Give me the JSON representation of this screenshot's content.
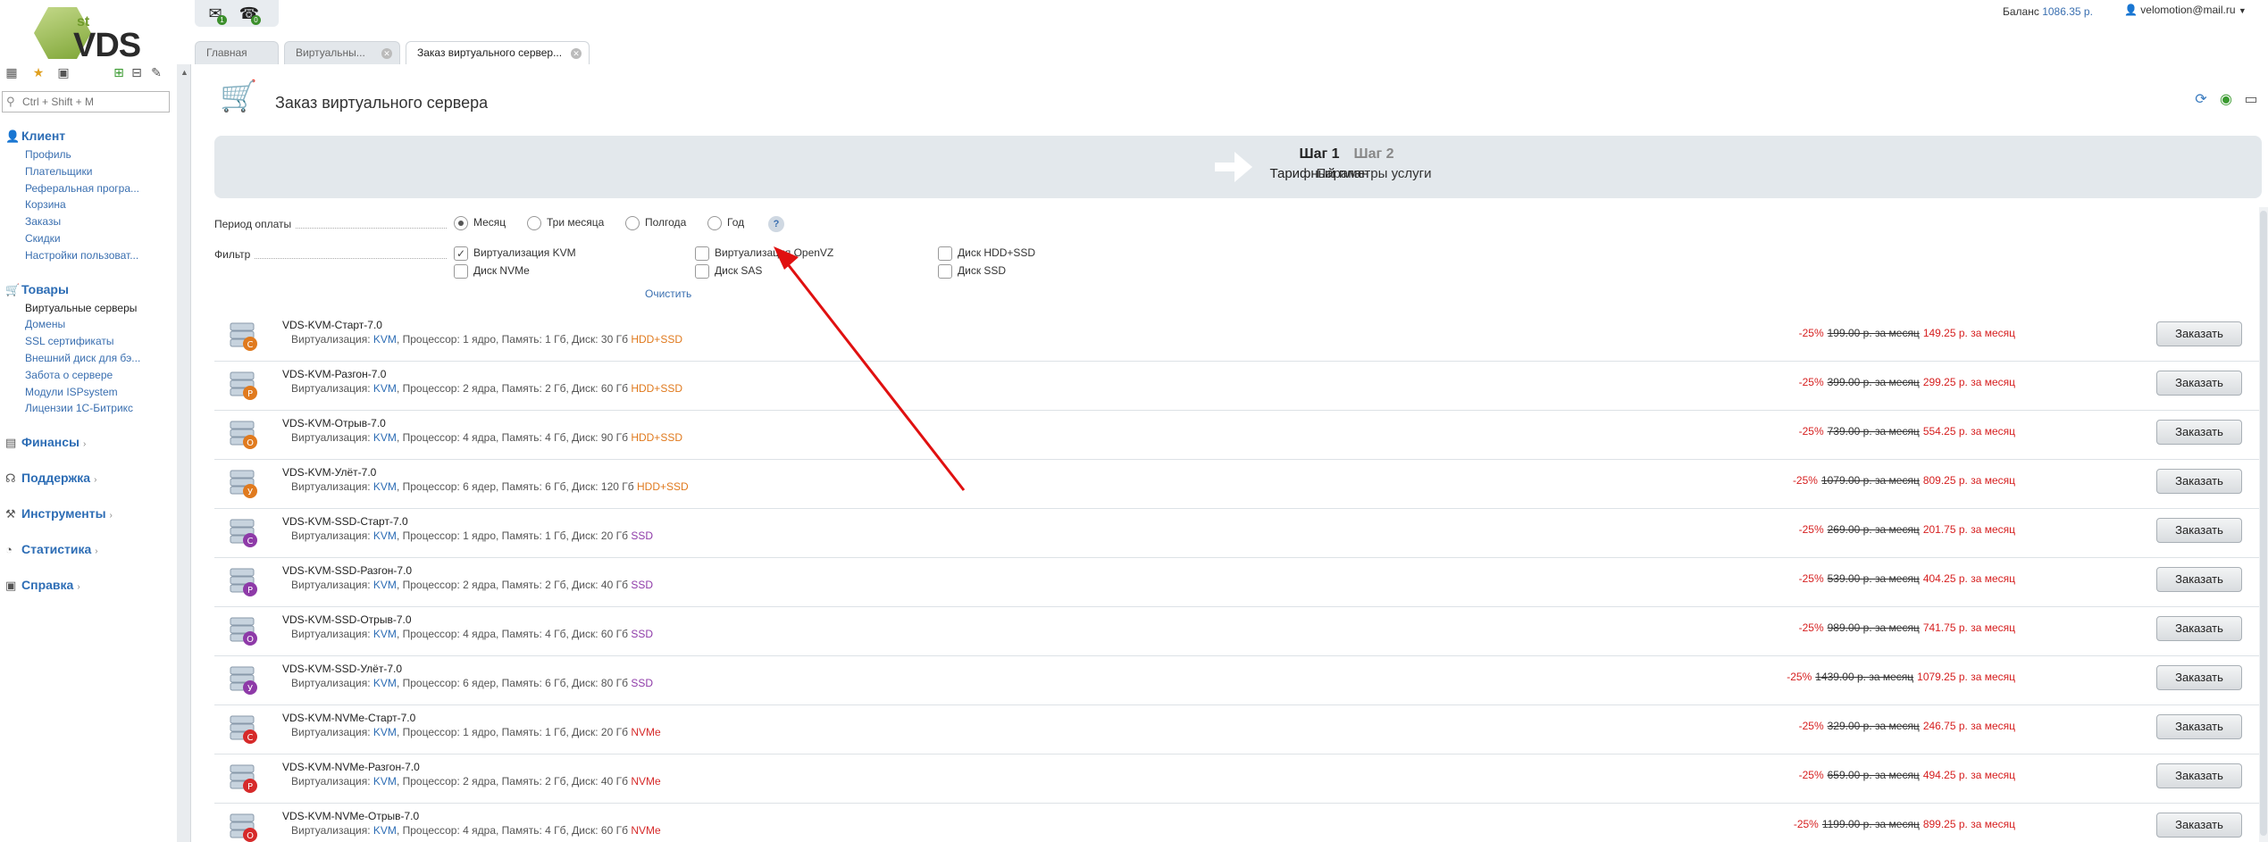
{
  "header": {
    "logo_sup": "st",
    "logo_text": "VDS",
    "balance_label": "Баланс",
    "balance_value": "1086.35 р.",
    "user_email": "velomotion@mail.ru"
  },
  "topbar_icons": [
    {
      "icon": "news-icon",
      "badge": "1"
    },
    {
      "icon": "support-icon",
      "badge": "0"
    }
  ],
  "tabs": [
    {
      "label": "Главная",
      "closable": false
    },
    {
      "label": "Виртуальны...",
      "closable": true
    },
    {
      "label": "Заказ виртуального сервер...",
      "closable": true,
      "active": true
    }
  ],
  "sidebar": {
    "search_placeholder": "Ctrl + Shift + M",
    "sections": [
      {
        "label": "Клиент",
        "icon": "client-icon",
        "items": [
          "Профиль",
          "Плательщики",
          "Реферальная програ...",
          "Корзина",
          "Заказы",
          "Скидки",
          "Настройки пользоват..."
        ]
      },
      {
        "label": "Товары",
        "icon": "cart-icon",
        "items": [
          "Виртуальные серверы",
          "Домены",
          "SSL сертификаты",
          "Внешний диск для бэ...",
          "Забота о сервере",
          "Модули ISPsystem",
          "Лицензии 1С-Битрикс"
        ]
      },
      {
        "label": "Финансы",
        "icon": "finance-icon",
        "items": []
      },
      {
        "label": "Поддержка",
        "icon": "headset-icon",
        "items": []
      },
      {
        "label": "Инструменты",
        "icon": "tools-icon",
        "items": []
      },
      {
        "label": "Статистика",
        "icon": "stats-icon",
        "items": []
      },
      {
        "label": "Справка",
        "icon": "help-book-icon",
        "items": []
      }
    ]
  },
  "page": {
    "title": "Заказ виртуального сервера",
    "step1_title": "Шаг 1",
    "step1_sub": "Тарифный план",
    "step2_title": "Шаг 2",
    "step2_sub": "Параметры услуги"
  },
  "form": {
    "period_label": "Период оплаты",
    "periods": [
      "Месяц",
      "Три месяца",
      "Полгода",
      "Год"
    ],
    "period_selected": "Месяц",
    "filter_label": "Фильтр",
    "filters": [
      {
        "label": "Виртуализация KVM",
        "checked": true
      },
      {
        "label": "Диск NVMe",
        "checked": false
      },
      {
        "label": "Виртуализация OpenVZ",
        "checked": false
      },
      {
        "label": "Диск SAS",
        "checked": false
      },
      {
        "label": "Диск HDD+SSD",
        "checked": false
      },
      {
        "label": "Диск SSD",
        "checked": false
      }
    ],
    "clear_label": "Очистить",
    "help_label": "?"
  },
  "products": [
    {
      "name": "VDS-KVM-Старт-7.0",
      "desc_prefix": "Виртуализация: ",
      "virt": "KVM",
      "desc_mid": ", Процессор: 1 ядро, Память: 1 Гб, Диск: 30 Гб ",
      "disk": "HDD+SSD",
      "disk_kind": "hdd",
      "letter": "С",
      "discount": "-25%",
      "old_price": "199.00 р. за месяц",
      "new_price": "149.25 р. за месяц",
      "button": "Заказать"
    },
    {
      "name": "VDS-KVM-Разгон-7.0",
      "desc_prefix": "Виртуализация: ",
      "virt": "KVM",
      "desc_mid": ", Процессор: 2 ядра, Память: 2 Гб, Диск: 60 Гб ",
      "disk": "HDD+SSD",
      "disk_kind": "hdd",
      "letter": "Р",
      "discount": "-25%",
      "old_price": "399.00 р. за месяц",
      "new_price": "299.25 р. за месяц",
      "button": "Заказать"
    },
    {
      "name": "VDS-KVM-Отрыв-7.0",
      "desc_prefix": "Виртуализация: ",
      "virt": "KVM",
      "desc_mid": ", Процессор: 4 ядра, Память: 4 Гб, Диск: 90 Гб ",
      "disk": "HDD+SSD",
      "disk_kind": "hdd",
      "letter": "О",
      "discount": "-25%",
      "old_price": "739.00 р. за месяц",
      "new_price": "554.25 р. за месяц",
      "button": "Заказать"
    },
    {
      "name": "VDS-KVM-Улёт-7.0",
      "desc_prefix": "Виртуализация: ",
      "virt": "KVM",
      "desc_mid": ", Процессор: 6 ядер, Память: 6 Гб, Диск: 120 Гб ",
      "disk": "HDD+SSD",
      "disk_kind": "hdd",
      "letter": "У",
      "discount": "-25%",
      "old_price": "1079.00 р. за месяц",
      "new_price": "809.25 р. за месяц",
      "button": "Заказать"
    },
    {
      "name": "VDS-KVM-SSD-Старт-7.0",
      "desc_prefix": "Виртуализация: ",
      "virt": "KVM",
      "desc_mid": ", Процессор: 1 ядро, Память: 1 Гб, Диск: 20 Гб ",
      "disk": "SSD",
      "disk_kind": "ssd",
      "letter": "С",
      "discount": "-25%",
      "old_price": "269.00 р. за месяц",
      "new_price": "201.75 р. за месяц",
      "button": "Заказать"
    },
    {
      "name": "VDS-KVM-SSD-Разгон-7.0",
      "desc_prefix": "Виртуализация: ",
      "virt": "KVM",
      "desc_mid": ", Процессор: 2 ядра, Память: 2 Гб, Диск: 40 Гб ",
      "disk": "SSD",
      "disk_kind": "ssd",
      "letter": "Р",
      "discount": "-25%",
      "old_price": "539.00 р. за месяц",
      "new_price": "404.25 р. за месяц",
      "button": "Заказать"
    },
    {
      "name": "VDS-KVM-SSD-Отрыв-7.0",
      "desc_prefix": "Виртуализация: ",
      "virt": "KVM",
      "desc_mid": ", Процессор: 4 ядра, Память: 4 Гб, Диск: 60 Гб ",
      "disk": "SSD",
      "disk_kind": "ssd",
      "letter": "О",
      "discount": "-25%",
      "old_price": "989.00 р. за месяц",
      "new_price": "741.75 р. за месяц",
      "button": "Заказать"
    },
    {
      "name": "VDS-KVM-SSD-Улёт-7.0",
      "desc_prefix": "Виртуализация: ",
      "virt": "KVM",
      "desc_mid": ", Процессор: 6 ядер, Память: 6 Гб, Диск: 80 Гб ",
      "disk": "SSD",
      "disk_kind": "ssd",
      "letter": "У",
      "discount": "-25%",
      "old_price": "1439.00 р. за месяц",
      "new_price": "1079.25 р. за месяц",
      "button": "Заказать"
    },
    {
      "name": "VDS-KVM-NVMe-Старт-7.0",
      "desc_prefix": "Виртуализация: ",
      "virt": "KVM",
      "desc_mid": ", Процессор: 1 ядро, Память: 1 Гб, Диск: 20 Гб ",
      "disk": "NVMe",
      "disk_kind": "nvme",
      "letter": "С",
      "discount": "-25%",
      "old_price": "329.00 р. за месяц",
      "new_price": "246.75 р. за месяц",
      "button": "Заказать"
    },
    {
      "name": "VDS-KVM-NVMe-Разгон-7.0",
      "desc_prefix": "Виртуализация: ",
      "virt": "KVM",
      "desc_mid": ", Процессор: 2 ядра, Память: 2 Гб, Диск: 40 Гб ",
      "disk": "NVMe",
      "disk_kind": "nvme",
      "letter": "Р",
      "discount": "-25%",
      "old_price": "659.00 р. за месяц",
      "new_price": "494.25 р. за месяц",
      "button": "Заказать"
    },
    {
      "name": "VDS-KVM-NVMe-Отрыв-7.0",
      "desc_prefix": "Виртуализация: ",
      "virt": "KVM",
      "desc_mid": ", Процессор: 4 ядра, Память: 4 Гб, Диск: 60 Гб ",
      "disk": "NVMe",
      "disk_kind": "nvme",
      "letter": "О",
      "discount": "-25%",
      "old_price": "1199.00 р. за месяц",
      "new_price": "899.25 р. за месяц",
      "button": "Заказать"
    }
  ],
  "colors": {
    "link": "#3a6fb0",
    "discount": "#d62020",
    "hdd": "#e07a1e",
    "ssd": "#8e3aa8",
    "nvme": "#d62a2a",
    "annotation_arrow": "#e01010"
  }
}
